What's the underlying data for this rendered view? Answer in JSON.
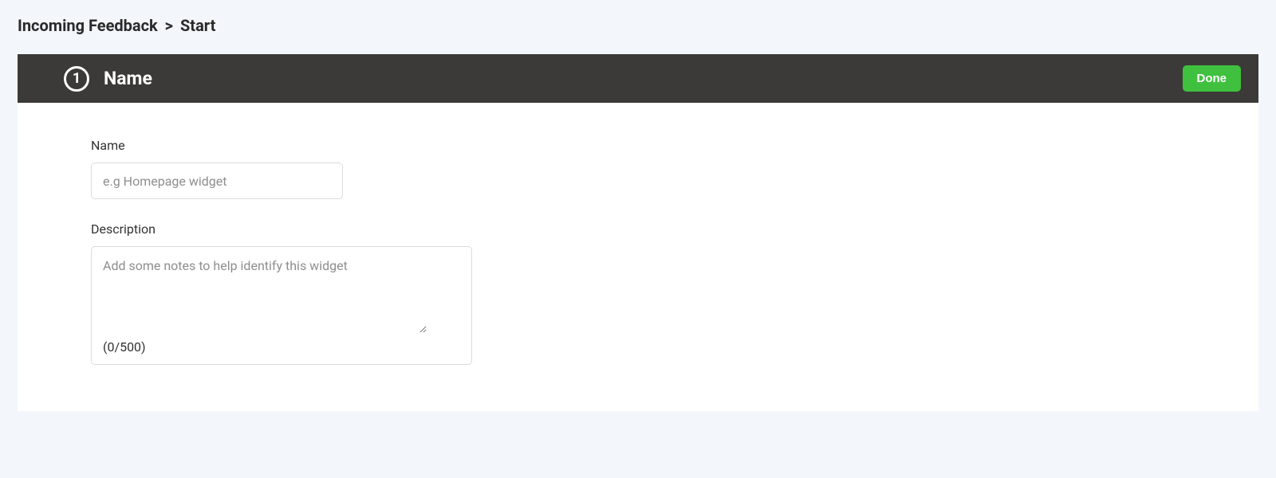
{
  "breadcrumb": {
    "root": "Incoming Feedback",
    "sep": ">",
    "current": "Start"
  },
  "panel": {
    "step_number": "1",
    "title": "Name",
    "done_label": "Done"
  },
  "form": {
    "name_label": "Name",
    "name_placeholder": "e.g Homepage widget",
    "name_value": "",
    "description_label": "Description",
    "description_placeholder": "Add some notes to help identify this widget",
    "description_value": "",
    "description_counter": "(0/500)"
  }
}
